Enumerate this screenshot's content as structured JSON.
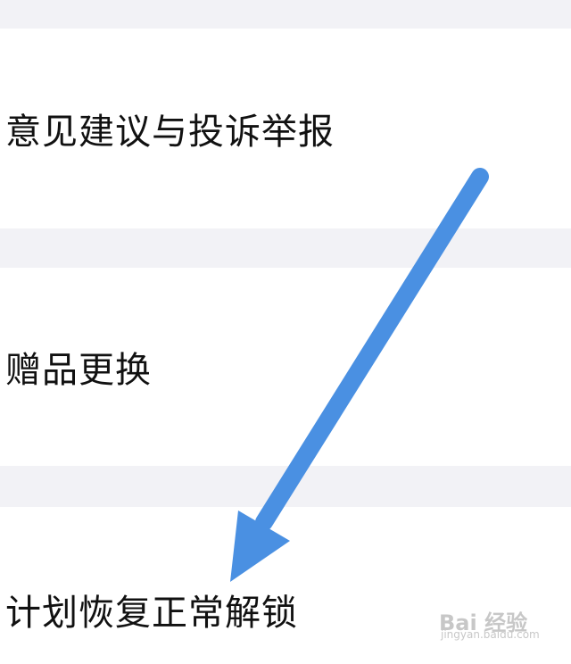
{
  "menu": {
    "items": [
      {
        "label": "意见建议与投诉举报"
      },
      {
        "label": "赠品更换"
      },
      {
        "label": "计划恢复正常解锁"
      }
    ]
  },
  "overlay": {
    "arrow_color": "#4a90e2",
    "arrow_icon": "arrow-down-left-icon"
  },
  "watermark": {
    "text": "Bai 经验",
    "subtext": "jingyan.baidu.com"
  },
  "colors": {
    "background": "#ffffff",
    "separator": "#f2f2f6",
    "text": "#111111"
  }
}
